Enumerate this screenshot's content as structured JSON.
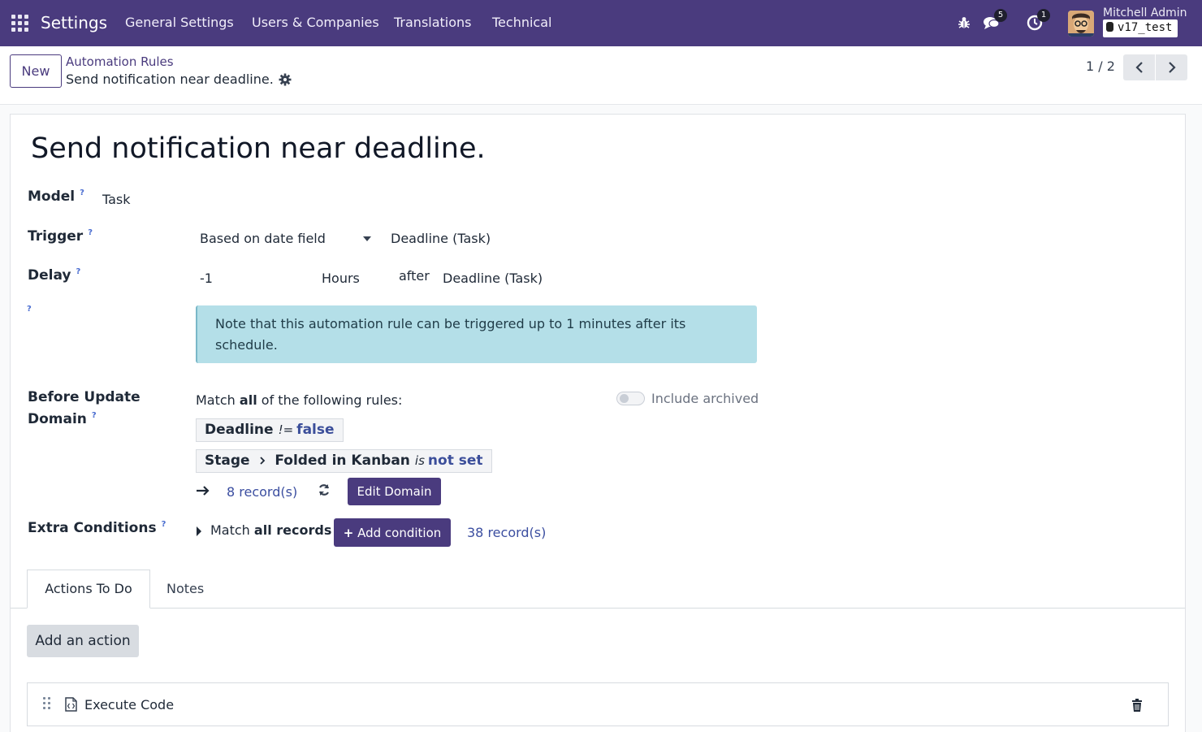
{
  "navbar": {
    "brand": "Settings",
    "menu": [
      "General Settings",
      "Users & Companies",
      "Translations",
      "Technical"
    ],
    "messages_count": "5",
    "activities_count": "1",
    "user_name": "Mitchell Admin",
    "database": "v17_test"
  },
  "control_panel": {
    "new_label": "New",
    "breadcrumb_parent": "Automation Rules",
    "breadcrumb_current": "Send notification near deadline.",
    "pager": "1 / 2"
  },
  "form": {
    "title": "Send notification near deadline.",
    "model_label": "Model",
    "model_value": "Task",
    "trigger_label": "Trigger",
    "trigger_value": "Based on date field",
    "trigger_date_field": "Deadline (Task)",
    "delay_label": "Delay",
    "delay_number": "-1",
    "delay_unit": "Hours",
    "delay_relation": "after",
    "delay_date_field": "Deadline (Task)",
    "help_mark": "?",
    "alert_text": "Note that this automation rule can be triggered up to 1 minutes after its schedule.",
    "before_update_label_1": "Before Update",
    "before_update_label_2": "Domain",
    "match_prefix": "Match",
    "match_all": "all",
    "match_suffix": "of the following rules:",
    "include_archived": "Include archived",
    "rule1_field": "Deadline",
    "rule1_op": "!=",
    "rule1_value": "false",
    "rule2_field_a": "Stage",
    "rule2_field_b": "Folded in Kanban",
    "rule2_op": "is",
    "rule2_value": "not set",
    "domain_records": "8 record(s)",
    "edit_domain": "Edit Domain",
    "extra_conditions_label": "Extra Conditions",
    "extra_match_prefix": "Match",
    "extra_match_all": "all records",
    "add_condition": "Add condition",
    "extra_records": "38 record(s)"
  },
  "tabs": [
    "Actions To Do",
    "Notes"
  ],
  "actions": {
    "add_action": "Add an action",
    "rows": [
      {
        "name": "Execute Code"
      }
    ]
  },
  "colors": {
    "navbar": "#4a3b7e",
    "primary": "#4a3b7e",
    "alert_bg": "#b4dfe8",
    "link": "#3b4ea0"
  }
}
